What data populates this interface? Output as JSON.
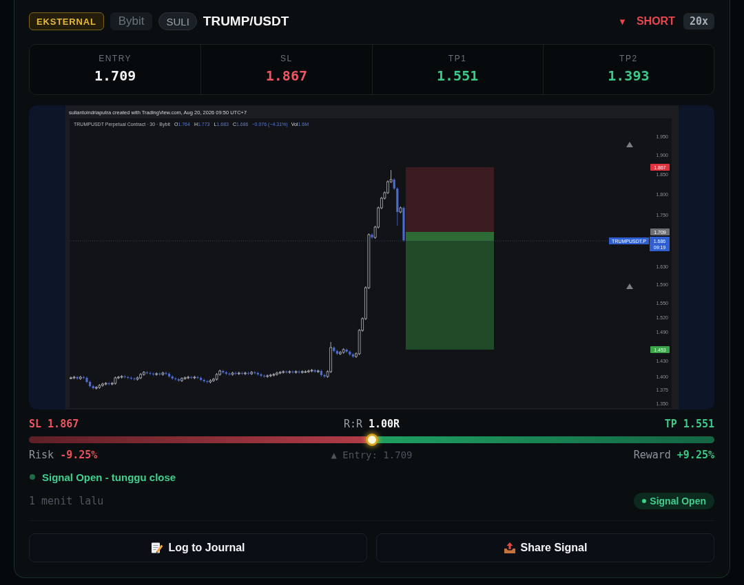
{
  "header": {
    "badges": [
      {
        "kind": "source",
        "label": "EKSTERNAL"
      },
      {
        "kind": "exchange",
        "label": "Bybit"
      },
      {
        "kind": "author",
        "label": "SULI"
      }
    ],
    "pair": "TRUMP/USDT",
    "side": {
      "kind": "short",
      "arrow": "▼",
      "label": "SHORT"
    },
    "leverage": "20x"
  },
  "levels": [
    {
      "kind": "entry",
      "label": "ENTRY",
      "value": "1.709"
    },
    {
      "kind": "sl",
      "label": "SL",
      "value": "1.867"
    },
    {
      "kind": "tp",
      "label": "TP1",
      "value": "1.551"
    },
    {
      "kind": "tp",
      "label": "TP2",
      "value": "1.393"
    }
  ],
  "chart_screenshot": {
    "credit": "suliantoindriaputra created with TradingView.com, Aug 20, 2026 09:50 UTC+7",
    "legend": {
      "title": "TRUMPUSDT Perpetual Contract · 30 · Bybit",
      "ohlc": [
        {
          "key": "O",
          "value": "1.764"
        },
        {
          "key": "H",
          "value": "1.773"
        },
        {
          "key": "L",
          "value": "1.683"
        },
        {
          "key": "C",
          "value": "1.686"
        }
      ],
      "change": "−0.076 (−4.31%)",
      "volume": {
        "key": "Vol",
        "value": "1.6M"
      }
    },
    "price_axis": [
      "1.950",
      "1.900",
      "1.850",
      "1.800",
      "1.750",
      "1.630",
      "1.590",
      "1.550",
      "1.520",
      "1.490",
      "1.430",
      "1.400",
      "1.375",
      "1.350"
    ],
    "tags": [
      {
        "kind": "sl",
        "value": "1.867"
      },
      {
        "kind": "entry",
        "value": "1.709"
      },
      {
        "kind": "last",
        "symbol": "TRUMPUSDT.P",
        "value": "1.686",
        "time": "09:19"
      },
      {
        "kind": "tp",
        "value": "1.453"
      }
    ]
  },
  "risk_reward": {
    "sl_label": "SL 1.867",
    "ratio_label": "R:R",
    "ratio": "1.00R",
    "tp_label": "TP 1.551",
    "level": 0.5,
    "risk_label": "Risk",
    "risk": "-9.25%",
    "entry_note": "▲ Entry: 1.709",
    "reward_label": "Reward",
    "reward": "+9.25%"
  },
  "status": {
    "message": "Signal Open - tunggu close",
    "time": "1 menit lalu",
    "badge": "Signal Open"
  },
  "buttons": [
    {
      "kind": "journal",
      "label": "Log to Journal"
    },
    {
      "kind": "share",
      "label": "Share Signal"
    }
  ]
}
